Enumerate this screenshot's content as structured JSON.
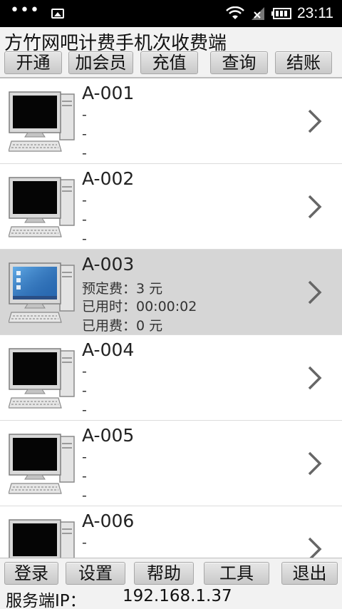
{
  "status_bar": {
    "time": "23:11",
    "icons": [
      "more-dots-icon",
      "image-icon",
      "wifi-icon",
      "signal-icon",
      "battery-icon"
    ]
  },
  "app": {
    "title": "方竹网吧计费手机次收费端"
  },
  "toolbar": {
    "open_label": "开通",
    "add_member_label": "加会员",
    "recharge_label": "充值",
    "query_label": "查询",
    "checkout_label": "结账"
  },
  "machines": [
    {
      "name": "A-001",
      "line1": "-",
      "line2": "-",
      "line3": "-",
      "active": false
    },
    {
      "name": "A-002",
      "line1": "-",
      "line2": "-",
      "line3": "-",
      "active": false
    },
    {
      "name": "A-003",
      "line1": "预定费：3 元",
      "line2": "已用时：00:00:02",
      "line3": "已用费：0 元",
      "active": true
    },
    {
      "name": "A-004",
      "line1": "-",
      "line2": "-",
      "line3": "-",
      "active": false
    },
    {
      "name": "A-005",
      "line1": "-",
      "line2": "-",
      "line3": "-",
      "active": false
    },
    {
      "name": "A-006",
      "line1": "-",
      "line2": "-",
      "line3": "-",
      "active": false
    }
  ],
  "bottom_bar": {
    "login_label": "登录",
    "settings_label": "设置",
    "help_label": "帮助",
    "tools_label": "工具",
    "exit_label": "退出",
    "server_label": "服务端IP：",
    "server_ip": "192.168.1.37"
  },
  "colors": {
    "status_bar": "#000000",
    "panel_bg": "#f2f2f2",
    "selected_row": "#d6d6d6",
    "button_top": "#e6e6e6",
    "button_bottom": "#c9c9c9"
  }
}
